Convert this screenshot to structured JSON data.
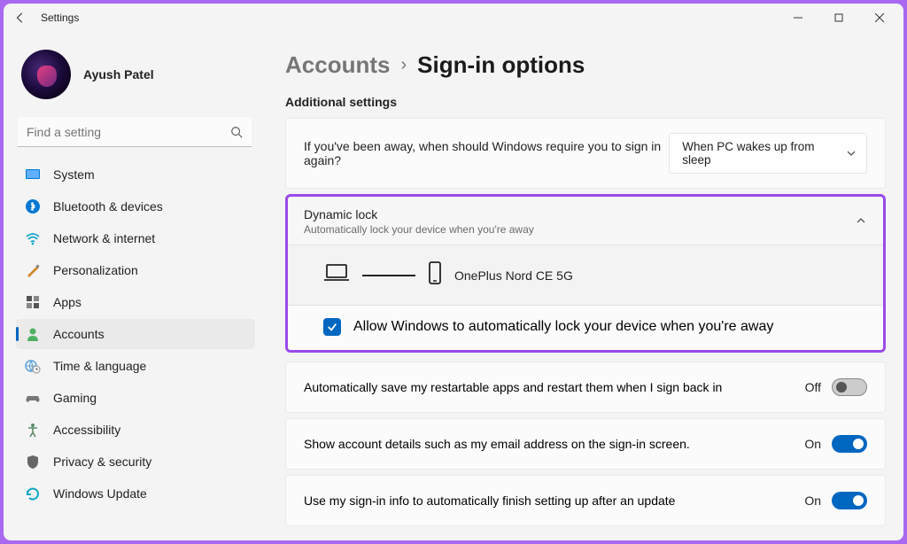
{
  "window": {
    "title": "Settings"
  },
  "profile": {
    "name": "Ayush Patel"
  },
  "search": {
    "placeholder": "Find a setting"
  },
  "nav": {
    "items": [
      {
        "label": "System"
      },
      {
        "label": "Bluetooth & devices"
      },
      {
        "label": "Network & internet"
      },
      {
        "label": "Personalization"
      },
      {
        "label": "Apps"
      },
      {
        "label": "Accounts"
      },
      {
        "label": "Time & language"
      },
      {
        "label": "Gaming"
      },
      {
        "label": "Accessibility"
      },
      {
        "label": "Privacy & security"
      },
      {
        "label": "Windows Update"
      }
    ]
  },
  "breadcrumb": {
    "parent": "Accounts",
    "current": "Sign-in options"
  },
  "section": {
    "heading": "Additional settings"
  },
  "require_signin": {
    "label": "If you've been away, when should Windows require you to sign in again?",
    "value": "When PC wakes up from sleep"
  },
  "dynamic_lock": {
    "title": "Dynamic lock",
    "subtitle": "Automatically lock your device when you're away",
    "device_name": "OnePlus Nord CE 5G",
    "checkbox_label": "Allow Windows to automatically lock your device when you're away"
  },
  "rows": {
    "restartable": {
      "label": "Automatically save my restartable apps and restart them when I sign back in",
      "state": "Off"
    },
    "account_details": {
      "label": "Show account details such as my email address on the sign-in screen.",
      "state": "On"
    },
    "finish_setup": {
      "label": "Use my sign-in info to automatically finish setting up after an update",
      "state": "On"
    }
  }
}
